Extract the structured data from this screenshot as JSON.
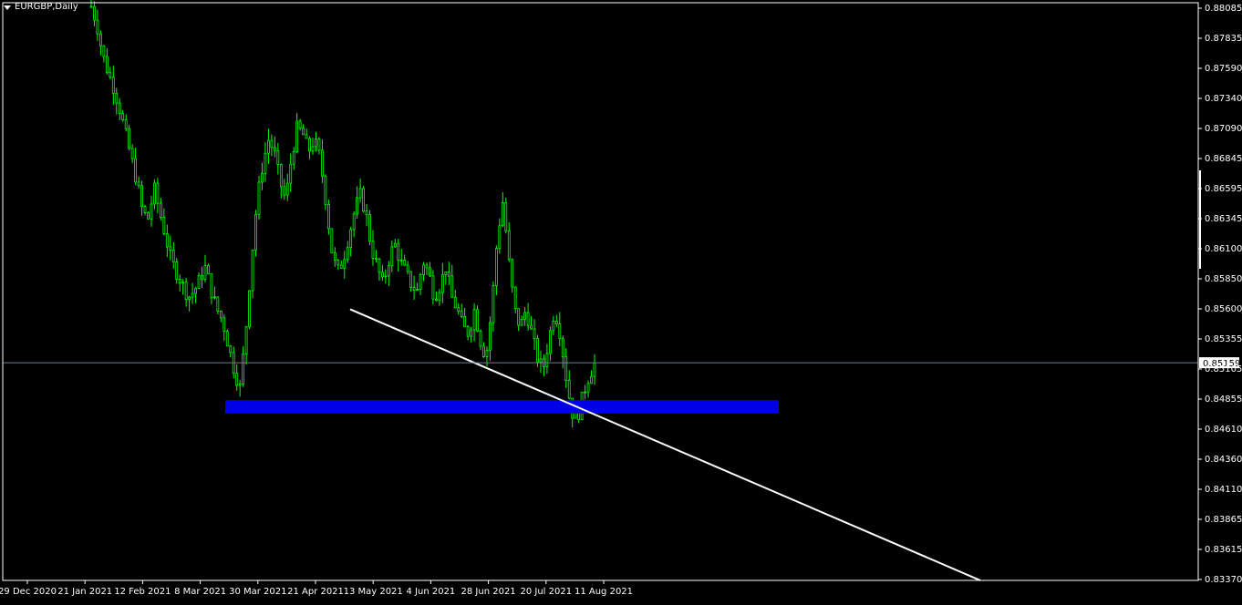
{
  "window": {
    "symbol_title": "EURGBP,Daily"
  },
  "colors": {
    "background": "#000000",
    "candle": "#00ff00",
    "axis": "#ffffff",
    "support_zone": "#0000e6",
    "trendline": "#ffffff",
    "bid_line": "#708090"
  },
  "chart_data": {
    "type": "candlestick",
    "symbol": "EURGBP",
    "timeframe": "Daily",
    "current_price": "0.85159",
    "price_axis_ticks": [
      "0.88085",
      "0.87835",
      "0.87590",
      "0.87340",
      "0.87090",
      "0.86845",
      "0.86595",
      "0.86345",
      "0.86100",
      "0.85850",
      "0.85600",
      "0.85355",
      "0.85105",
      "0.84855",
      "0.84610",
      "0.84360",
      "0.84110",
      "0.83865",
      "0.83615",
      "0.83370"
    ],
    "time_axis_ticks": [
      "29 Dec 2020",
      "21 Jan 2021",
      "12 Feb 2021",
      "8 Mar 2021",
      "30 Mar 2021",
      "21 Apr 2021",
      "13 May 2021",
      "4 Jun 2021",
      "28 Jun 2021",
      "20 Jul 2021",
      "11 Aug 2021"
    ],
    "ylim": [
      0.8337,
      0.88085
    ],
    "support_zone": {
      "low": 0.8474,
      "high": 0.8485,
      "from": "26 Mar 2021",
      "to": "after 11 Aug 2021"
    },
    "trendline": {
      "start": {
        "date": "13 May 2021",
        "price": 0.856
      },
      "end_price_at_axis": 0.8337
    },
    "price_path": [
      0.881,
      0.8795,
      0.877,
      0.8755,
      0.8742,
      0.8725,
      0.8705,
      0.8685,
      0.8665,
      0.864,
      0.8635,
      0.866,
      0.864,
      0.862,
      0.86,
      0.859,
      0.858,
      0.857,
      0.8575,
      0.8585,
      0.8595,
      0.8575,
      0.856,
      0.855,
      0.853,
      0.851,
      0.8495,
      0.854,
      0.86,
      0.865,
      0.868,
      0.87,
      0.869,
      0.8665,
      0.865,
      0.8685,
      0.871,
      0.8705,
      0.869,
      0.87,
      0.8685,
      0.865,
      0.861,
      0.859,
      0.86,
      0.862,
      0.864,
      0.8655,
      0.864,
      0.861,
      0.8595,
      0.858,
      0.86,
      0.8615,
      0.86,
      0.859,
      0.858,
      0.8575,
      0.86,
      0.859,
      0.857,
      0.858,
      0.8595,
      0.857,
      0.856,
      0.8545,
      0.854,
      0.856,
      0.8535,
      0.852,
      0.856,
      0.862,
      0.865,
      0.86,
      0.856,
      0.8545,
      0.856,
      0.854,
      0.852,
      0.851,
      0.8535,
      0.856,
      0.854,
      0.8505,
      0.8475,
      0.847,
      0.849,
      0.8505,
      0.8515
    ]
  }
}
